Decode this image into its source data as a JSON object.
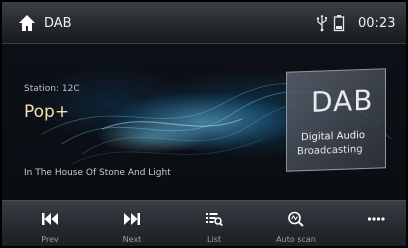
{
  "header": {
    "title": "DAB",
    "time": "00:23"
  },
  "station": {
    "label": "Station: 12C",
    "name": "Pop+"
  },
  "now_playing": {
    "title": "In The House Of Stone And Light"
  },
  "logo": {
    "big": "DAB",
    "line1": "Digital Audio",
    "line2": "Broadcasting"
  },
  "controls": [
    {
      "label": "Prev",
      "icon": "skip-previous-icon"
    },
    {
      "label": "Next",
      "icon": "skip-next-icon"
    },
    {
      "label": "List",
      "icon": "list-search-icon"
    },
    {
      "label": "Auto scan",
      "icon": "auto-scan-icon"
    },
    {
      "label": "",
      "icon": "more-icon"
    }
  ]
}
